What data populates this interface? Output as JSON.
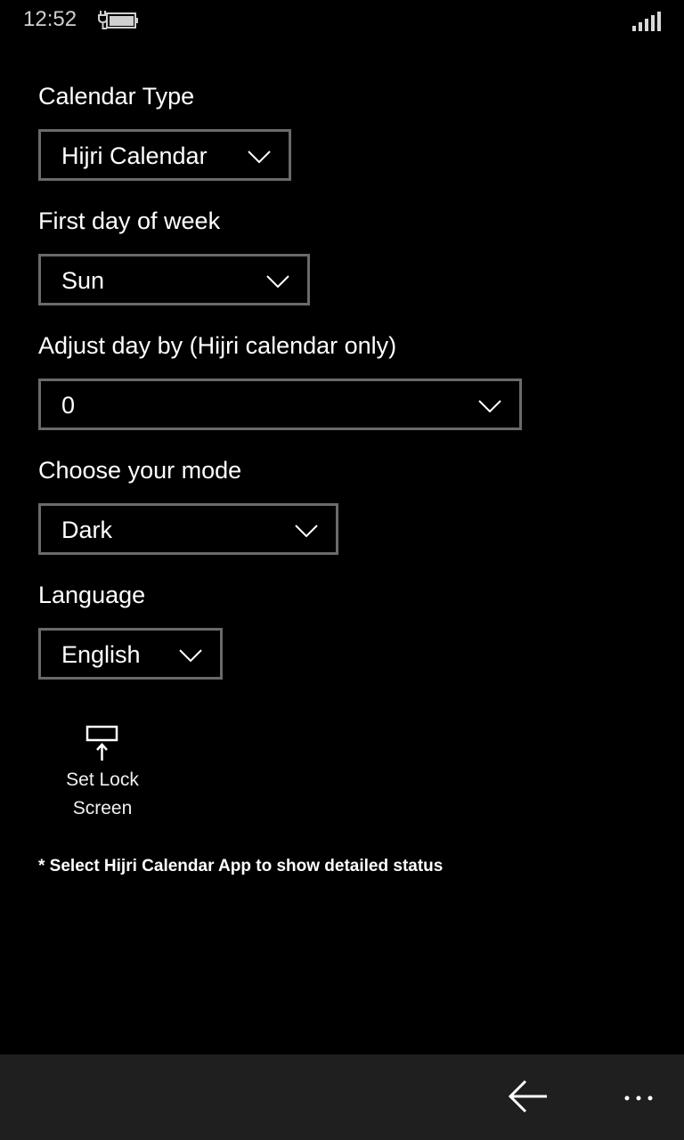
{
  "status_bar": {
    "time": "12:52",
    "battery_icon": "battery-charging-icon",
    "signal_icon": "signal-strength-icon"
  },
  "settings": {
    "calendar_type": {
      "label": "Calendar Type",
      "value": "Hijri Calendar"
    },
    "first_day": {
      "label": "First day of week",
      "value": "Sun"
    },
    "adjust_day": {
      "label": "Adjust day by (Hijri calendar only)",
      "value": "0"
    },
    "mode": {
      "label": "Choose your mode",
      "value": "Dark"
    },
    "language": {
      "label": "Language",
      "value": "English"
    }
  },
  "lock_screen_button": {
    "label_line1": "Set Lock",
    "label_line2": "Screen",
    "icon": "set-lock-screen-icon"
  },
  "note": "* Select Hijri Calendar App to show detailed status",
  "app_bar": {
    "back_icon": "back-arrow-icon",
    "more_icon": "more-icon"
  },
  "colors": {
    "background": "#000000",
    "combo_border": "#6a6a6a",
    "app_bar": "#1f1f1f"
  }
}
